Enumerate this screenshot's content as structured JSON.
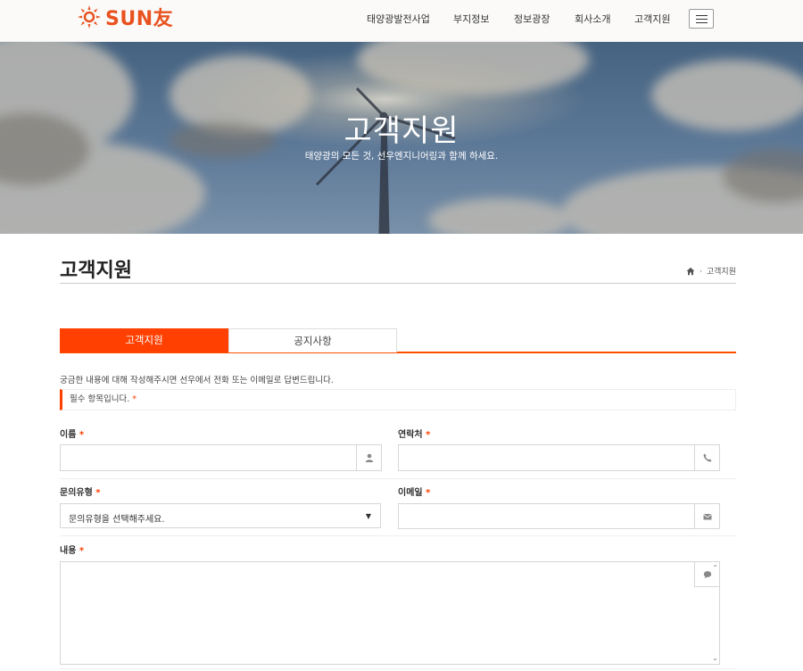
{
  "header": {
    "logo_text": "SUN友",
    "nav": [
      "태양광발전사업",
      "부지정보",
      "정보광장",
      "회사소개",
      "고객지원"
    ]
  },
  "hero": {
    "title": "고객지원",
    "subtitle": "태양광의 모든 것, 선우엔지니어링과 함께 하세요."
  },
  "page": {
    "title": "고객지원",
    "breadcrumb": "고객지원"
  },
  "tabs": [
    {
      "label": "고객지원",
      "active": true
    },
    {
      "label": "공지사항",
      "active": false
    }
  ],
  "form": {
    "intro": "궁금한 내용에 대해 작성해주시면 선우에서 전화 또는 이메일로 답변드립니다.",
    "required_notice": "필수 항목입니다.",
    "required_mark": "*",
    "name_label": "이름",
    "contact_label": "연락처",
    "type_label": "문의유형",
    "type_selected": "문의유형을 선택해주세요.",
    "email_label": "이메일",
    "content_label": "내용"
  },
  "colors": {
    "accent": "#ff4000",
    "logo": "#e9521f"
  }
}
